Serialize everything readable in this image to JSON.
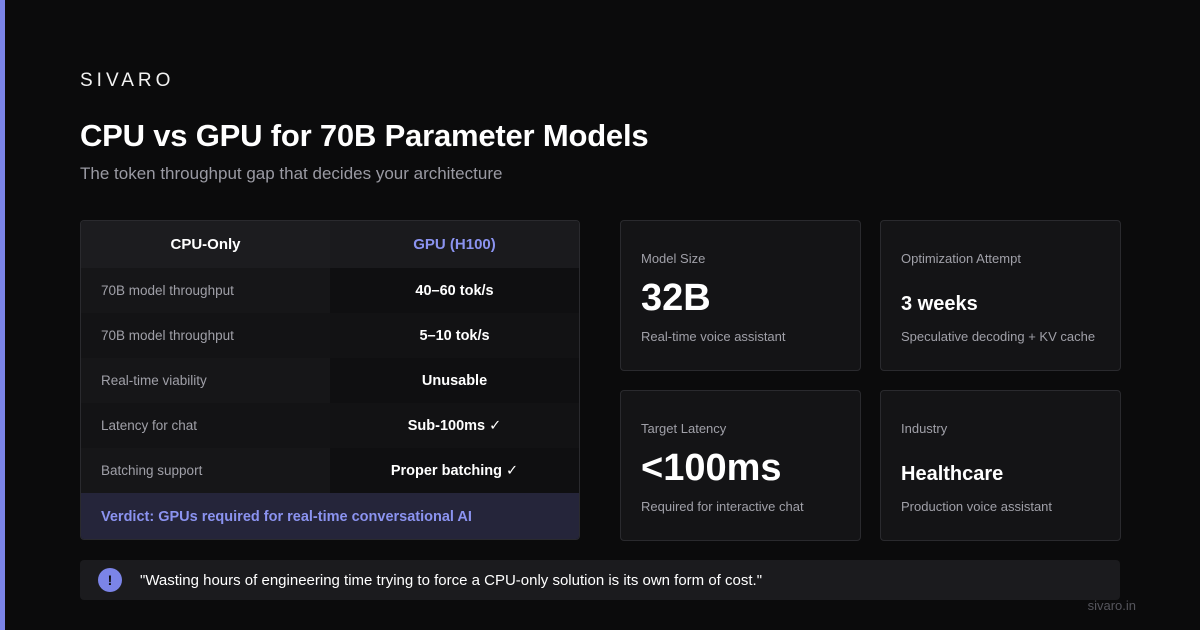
{
  "brand": "SIVARO",
  "title": "CPU vs GPU for 70B Parameter Models",
  "subtitle": "The token throughput gap that decides your architecture",
  "table": {
    "headers": [
      "CPU-Only",
      "GPU (H100)"
    ],
    "rows": [
      {
        "label": "70B model throughput",
        "value": "40–60 tok/s"
      },
      {
        "label": "70B model throughput",
        "value": "5–10 tok/s"
      },
      {
        "label": "Real-time viability",
        "value": "Unusable"
      },
      {
        "label": "Latency for chat",
        "value": "Sub-100ms ✓"
      },
      {
        "label": "Batching support",
        "value": "Proper batching ✓"
      }
    ],
    "verdict": "Verdict: GPUs required for real-time conversational AI"
  },
  "cards": [
    {
      "label": "Model Size",
      "value": "32B",
      "desc": "Real-time voice assistant"
    },
    {
      "label": "Optimization Attempt",
      "value": "3 weeks",
      "desc": "Speculative decoding + KV cache"
    },
    {
      "label": "Target Latency",
      "value": "<100ms",
      "desc": "Required for interactive chat"
    },
    {
      "label": "Industry",
      "value": "Healthcare",
      "desc": "Production voice assistant"
    }
  ],
  "quote": {
    "icon": "!",
    "text": "\"Wasting hours of engineering time trying to force a CPU-only solution is its own form of cost.\""
  },
  "footer_url": "sivaro.in",
  "colors": {
    "accent": "#7b84e8",
    "background": "#0b0b0c"
  }
}
